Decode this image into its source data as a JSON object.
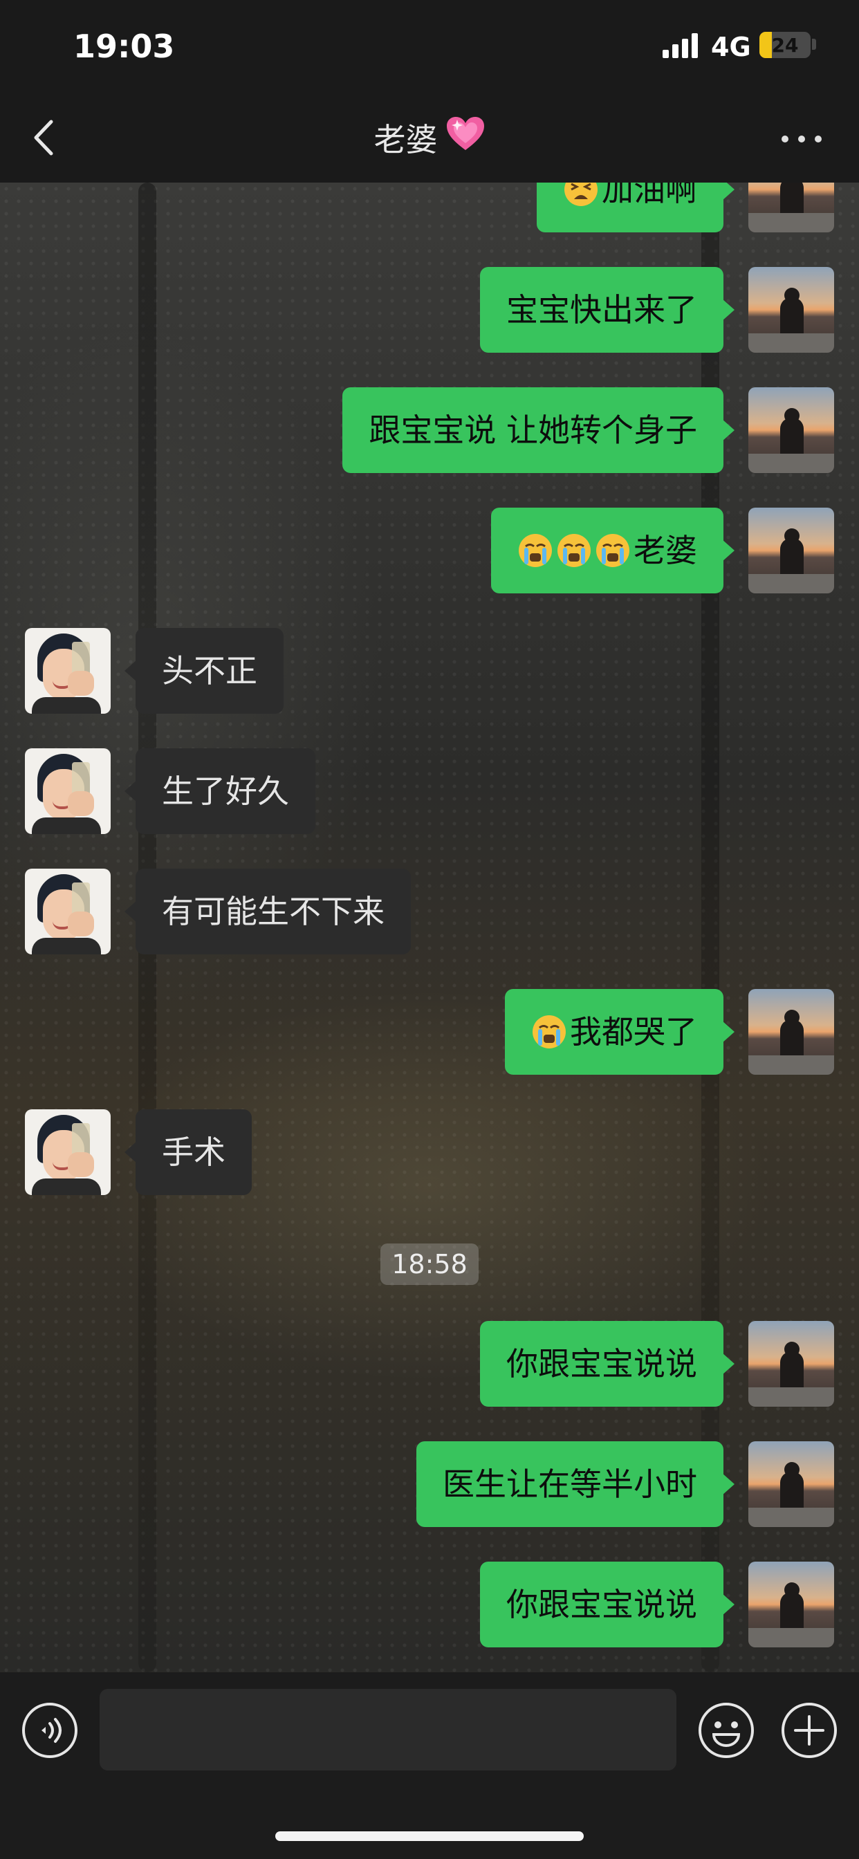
{
  "status_bar": {
    "time": "19:03",
    "network": "4G",
    "battery": "24",
    "battery_level": 0.24
  },
  "header": {
    "title": "老婆"
  },
  "colors": {
    "accent": "#38c45d",
    "header_bg": "#1a1a1a",
    "bubble_received": "#2c2c2c"
  },
  "messages": [
    {
      "from": "me",
      "text": "加油啊"
    },
    {
      "from": "me",
      "text": "宝宝快出来了"
    },
    {
      "from": "me",
      "text": "跟宝宝说 让她转个身子"
    },
    {
      "from": "me",
      "text": "老婆"
    },
    {
      "from": "her",
      "text": "头不正"
    },
    {
      "from": "her",
      "text": "生了好久"
    },
    {
      "from": "her",
      "text": "有可能生不下来"
    },
    {
      "from": "me",
      "text": "我都哭了"
    },
    {
      "from": "her",
      "text": "手术"
    },
    {
      "timestamp": "18:58"
    },
    {
      "from": "me",
      "text": "你跟宝宝说说"
    },
    {
      "from": "me",
      "text": "医生让在等半小时"
    },
    {
      "from": "me",
      "text": "你跟宝宝说说"
    }
  ],
  "icons": {
    "back": "chevron-left-icon",
    "more": "more-dots-icon",
    "title_emoji": "sparkling-heart-icon",
    "crying": "crying-face-icon",
    "weary": "weary-face-icon",
    "voice": "voice-icon",
    "emoji": "emoji-icon",
    "plus": "plus-icon"
  },
  "input": {
    "value": ""
  }
}
